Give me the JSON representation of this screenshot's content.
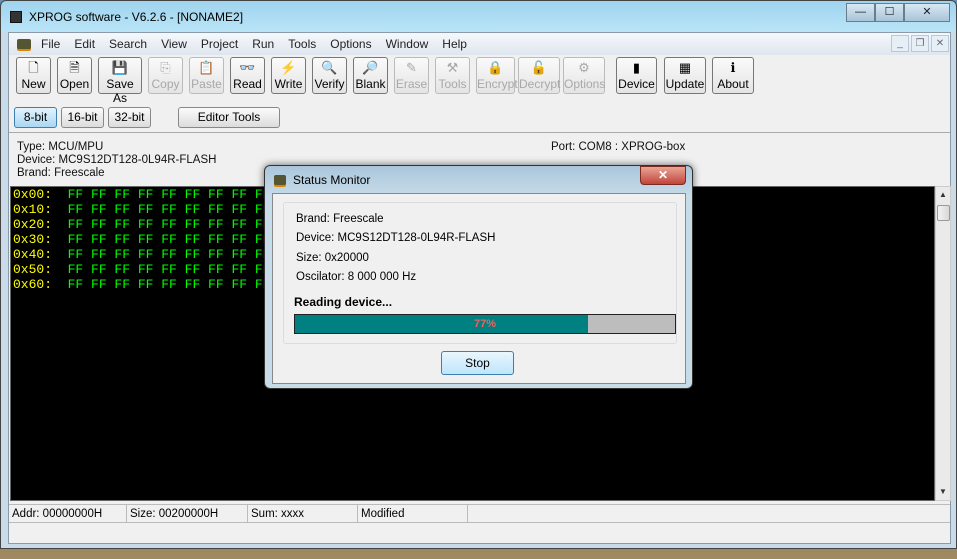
{
  "window": {
    "title": "XPROG software - V6.2.6 - [NONAME2]",
    "minimize": "—",
    "maximize": "☐",
    "close": "✕"
  },
  "menu": [
    "File",
    "Edit",
    "Search",
    "View",
    "Project",
    "Run",
    "Tools",
    "Options",
    "Window",
    "Help"
  ],
  "toolbar": [
    {
      "label": "New",
      "icon": "new-file-icon",
      "glyph": "🗋",
      "enabled": true
    },
    {
      "label": "Open",
      "icon": "open-file-icon",
      "glyph": "🗎",
      "enabled": true
    },
    {
      "label": "Save As",
      "icon": "save-as-icon",
      "glyph": "💾",
      "enabled": true
    },
    {
      "label": "Copy",
      "icon": "copy-icon",
      "glyph": "⎘",
      "enabled": false
    },
    {
      "label": "Paste",
      "icon": "paste-icon",
      "glyph": "📋",
      "enabled": false
    },
    {
      "label": "Read",
      "icon": "glasses-icon",
      "glyph": "👓",
      "enabled": true
    },
    {
      "label": "Write",
      "icon": "lightning-icon",
      "glyph": "⚡",
      "enabled": true
    },
    {
      "label": "Verify",
      "icon": "magnifier-icon",
      "glyph": "🔍",
      "enabled": true
    },
    {
      "label": "Blank",
      "icon": "blank-check-icon",
      "glyph": "🔎",
      "enabled": true
    },
    {
      "label": "Erase",
      "icon": "eraser-icon",
      "glyph": "✎",
      "enabled": false
    },
    {
      "label": "Tools",
      "icon": "tools-icon",
      "glyph": "⚒",
      "enabled": false
    },
    {
      "label": "Encrypt",
      "icon": "lock-icon",
      "glyph": "🔒",
      "enabled": false
    },
    {
      "label": "Decrypt",
      "icon": "unlock-icon",
      "glyph": "🔓",
      "enabled": false
    },
    {
      "label": "Options",
      "icon": "options-icon",
      "glyph": "⚙",
      "enabled": false
    },
    {
      "label": "Device",
      "icon": "chip-icon",
      "glyph": "▮",
      "enabled": true
    },
    {
      "label": "Update",
      "icon": "update-icon",
      "glyph": "▦",
      "enabled": true
    },
    {
      "label": "About",
      "icon": "info-icon",
      "glyph": "ℹ",
      "enabled": true
    }
  ],
  "bit_modes": [
    {
      "label": "8-bit",
      "selected": true
    },
    {
      "label": "16-bit",
      "selected": false
    },
    {
      "label": "32-bit",
      "selected": false
    }
  ],
  "editor_tools": "Editor Tools",
  "info": {
    "type": "Type: MCU/MPU",
    "device": "Device: MC9S12DT128-0L94R-FLASH",
    "brand": "Brand: Freescale",
    "port": "Port: COM8 : XPROG-box"
  },
  "hex": [
    {
      "addr": "0x00:",
      "bytes": "FF FF FF FF FF FF FF FF FF FF FF FF FF FF FF FF"
    },
    {
      "addr": "0x10:",
      "bytes": "FF FF FF FF FF FF FF FF FF FF FF FF FF FF FF FF"
    },
    {
      "addr": "0x20:",
      "bytes": "FF FF FF FF FF FF FF FF FF FF FF FF FF FF FF FF"
    },
    {
      "addr": "0x30:",
      "bytes": "FF FF FF FF FF FF FF FF FF FF FF FF FF FF FF FF"
    },
    {
      "addr": "0x40:",
      "bytes": "FF FF FF FF FF FF FF FF FF FF FF FF FF FF FF FF"
    },
    {
      "addr": "0x50:",
      "bytes": "FF FF FF FF FF FF FF FF FF FF FF FF FF FF FF FF"
    },
    {
      "addr": "0x60:",
      "bytes": "FF FF FF FF FF FF FF FF FF FF FF FF FF FF FF FF"
    }
  ],
  "statusbar": [
    "Addr: 00000000H",
    "Size: 00200000H",
    "Sum: xxxx",
    "Modified"
  ],
  "dialog": {
    "title": "Status Monitor",
    "close": "✕",
    "brand": "Brand: Freescale",
    "device": "Device: MC9S12DT128-0L94R-FLASH",
    "size": "Size: 0x20000",
    "oscilator": "Oscilator: 8 000 000 Hz",
    "status": "Reading device...",
    "progress": 77,
    "progress_label": "77%",
    "stop": "Stop",
    "colors": {
      "progress_fill": "#008080",
      "progress_text": "#f06060"
    }
  }
}
